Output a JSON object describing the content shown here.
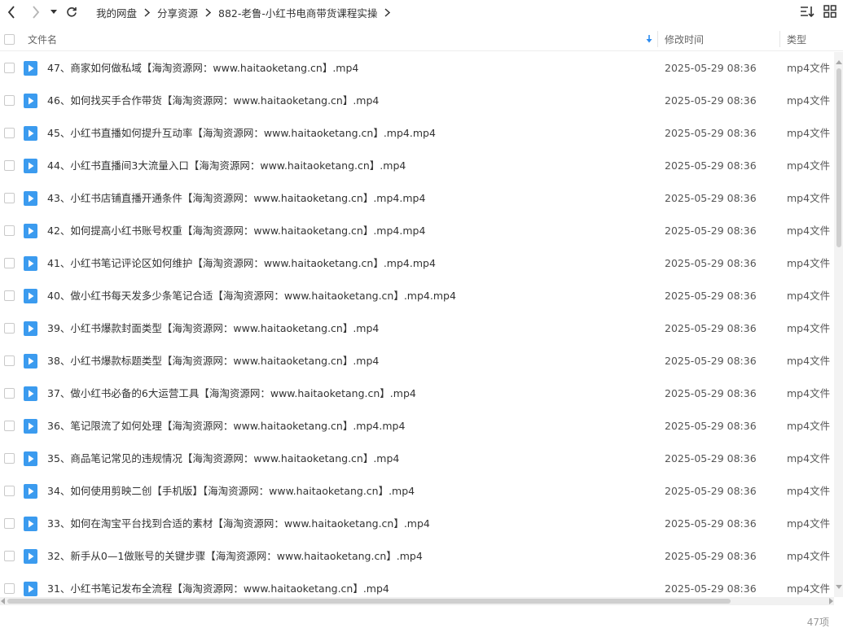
{
  "toolbar": {
    "breadcrumb": [
      "我的网盘",
      "分享资源",
      "882-老鲁-小红书电商带货课程实操"
    ]
  },
  "columns": {
    "name": "文件名",
    "modified": "修改时间",
    "type": "类型"
  },
  "files": [
    {
      "name": "47、商家如何做私域【海淘资源网：www.haitaoketang.cn】.mp4",
      "modified": "2025-05-29 08:36",
      "type": "mp4文件"
    },
    {
      "name": "46、如何找买手合作带货【海淘资源网：www.haitaoketang.cn】.mp4",
      "modified": "2025-05-29 08:36",
      "type": "mp4文件"
    },
    {
      "name": "45、小红书直播如何提升互动率【海淘资源网：www.haitaoketang.cn】.mp4.mp4",
      "modified": "2025-05-29 08:36",
      "type": "mp4文件"
    },
    {
      "name": "44、小红书直播间3大流量入口【海淘资源网：www.haitaoketang.cn】.mp4",
      "modified": "2025-05-29 08:36",
      "type": "mp4文件"
    },
    {
      "name": "43、小红书店铺直播开通条件【海淘资源网：www.haitaoketang.cn】.mp4.mp4",
      "modified": "2025-05-29 08:36",
      "type": "mp4文件"
    },
    {
      "name": "42、如何提高小红书账号权重【海淘资源网：www.haitaoketang.cn】.mp4.mp4",
      "modified": "2025-05-29 08:36",
      "type": "mp4文件"
    },
    {
      "name": "41、小红书笔记评论区如何维护【海淘资源网：www.haitaoketang.cn】.mp4.mp4",
      "modified": "2025-05-29 08:36",
      "type": "mp4文件"
    },
    {
      "name": "40、做小红书每天发多少条笔记合适【海淘资源网：www.haitaoketang.cn】.mp4.mp4",
      "modified": "2025-05-29 08:36",
      "type": "mp4文件"
    },
    {
      "name": "39、小红书爆款封面类型【海淘资源网：www.haitaoketang.cn】.mp4",
      "modified": "2025-05-29 08:36",
      "type": "mp4文件"
    },
    {
      "name": "38、小红书爆款标题类型【海淘资源网：www.haitaoketang.cn】.mp4",
      "modified": "2025-05-29 08:36",
      "type": "mp4文件"
    },
    {
      "name": "37、做小红书必备的6大运营工具【海淘资源网：www.haitaoketang.cn】.mp4",
      "modified": "2025-05-29 08:36",
      "type": "mp4文件"
    },
    {
      "name": "36、笔记限流了如何处理【海淘资源网：www.haitaoketang.cn】.mp4.mp4",
      "modified": "2025-05-29 08:36",
      "type": "mp4文件"
    },
    {
      "name": "35、商品笔记常见的违规情况【海淘资源网：www.haitaoketang.cn】.mp4",
      "modified": "2025-05-29 08:36",
      "type": "mp4文件"
    },
    {
      "name": "34、如何使用剪映二创【手机版】【海淘资源网：www.haitaoketang.cn】.mp4",
      "modified": "2025-05-29 08:36",
      "type": "mp4文件"
    },
    {
      "name": "33、如何在淘宝平台找到合适的素材【海淘资源网：www.haitaoketang.cn】.mp4",
      "modified": "2025-05-29 08:36",
      "type": "mp4文件"
    },
    {
      "name": "32、新手从0—1做账号的关键步骤【海淘资源网：www.haitaoketang.cn】.mp4",
      "modified": "2025-05-29 08:36",
      "type": "mp4文件"
    },
    {
      "name": "31、小红书笔记发布全流程【海淘资源网：www.haitaoketang.cn】.mp4",
      "modified": "2025-05-29 08:36",
      "type": "mp4文件"
    }
  ],
  "status": {
    "count": "47项"
  },
  "colors": {
    "icon_blue": "#3b9bef",
    "sort_arrow": "#2d8cf0"
  },
  "icons": [
    "back-arrow-icon",
    "forward-arrow-icon",
    "history-dropdown-icon",
    "refresh-icon",
    "sort-icon",
    "grid-view-icon",
    "video-file-icon",
    "sort-desc-icon"
  ]
}
